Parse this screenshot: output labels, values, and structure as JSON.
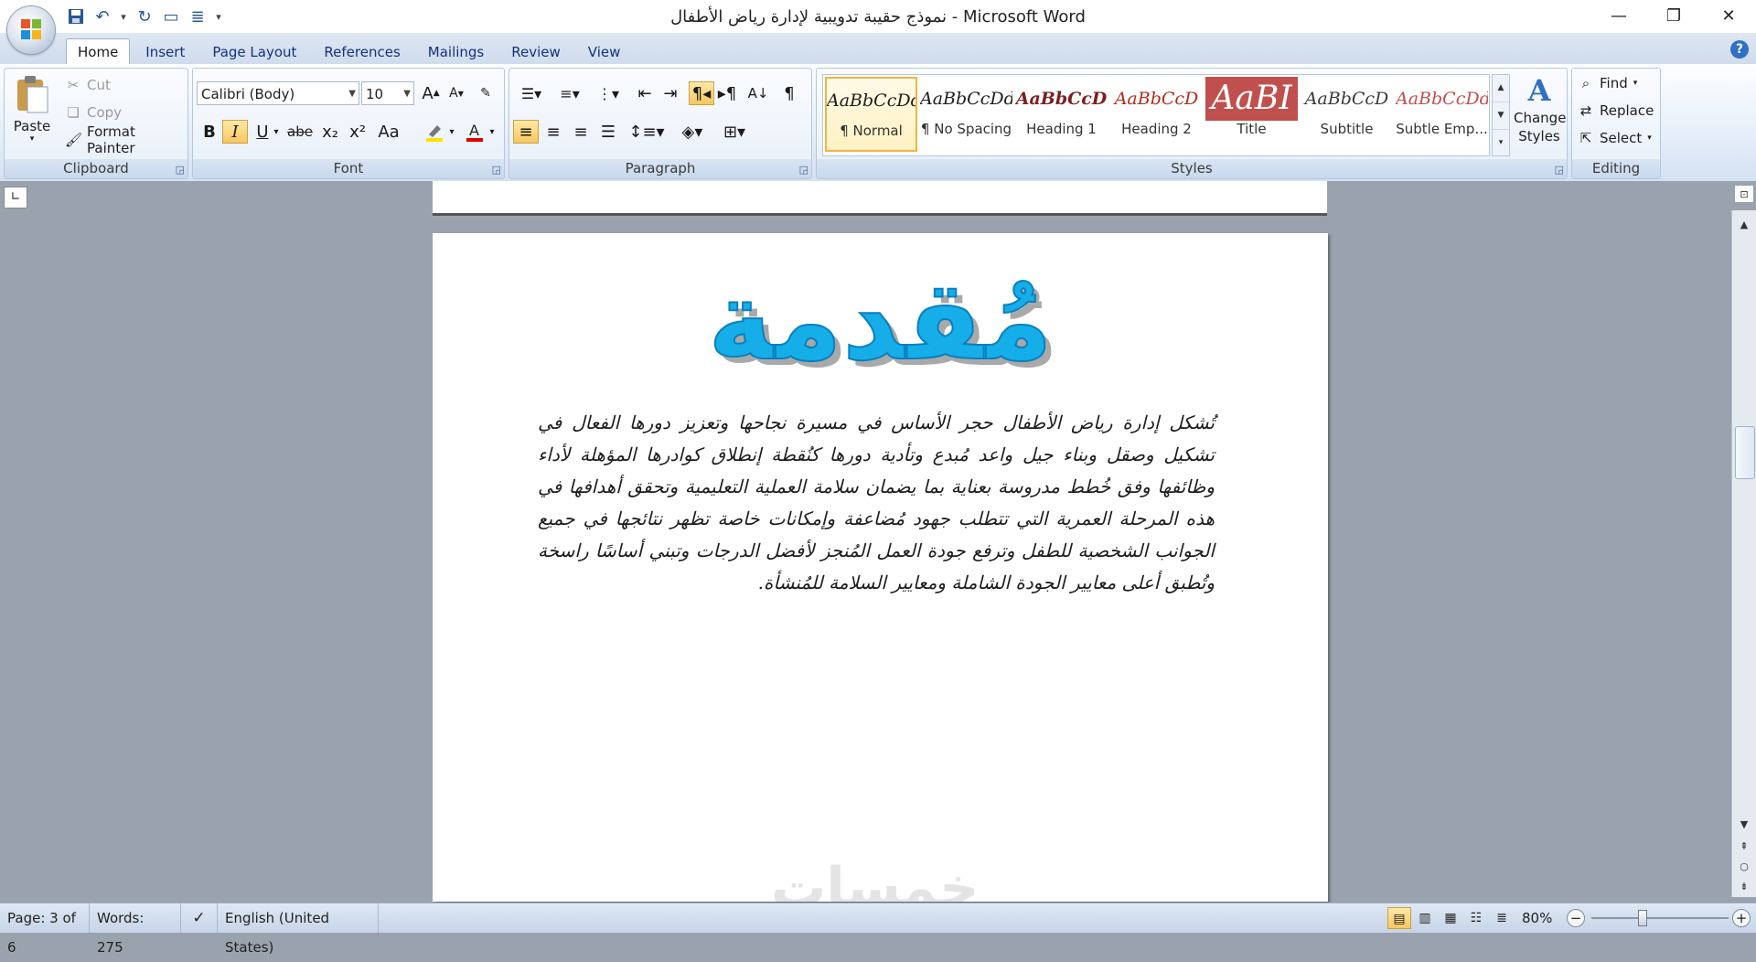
{
  "app": {
    "window_title": "نموذج حقيبة تدويبية لإدارة رياض الأطفال - Microsoft Word"
  },
  "tabs": [
    {
      "label": "Home",
      "active": true
    },
    {
      "label": "Insert"
    },
    {
      "label": "Page Layout"
    },
    {
      "label": "References"
    },
    {
      "label": "Mailings"
    },
    {
      "label": "Review"
    },
    {
      "label": "View"
    }
  ],
  "clipboard": {
    "group_label": "Clipboard",
    "paste": "Paste",
    "cut": "Cut",
    "copy": "Copy",
    "format_painter": "Format Painter"
  },
  "font": {
    "group_label": "Font",
    "font_name": "Calibri (Body)",
    "font_size": "10",
    "bold": "B",
    "italic": "I",
    "underline": "U",
    "strikethrough": "abe",
    "subscript": "x₂",
    "superscript": "x²",
    "change_case": "Aa"
  },
  "paragraph": {
    "group_label": "Paragraph",
    "pilcrow": "¶"
  },
  "styles": {
    "group_label": "Styles",
    "items": [
      {
        "sample": "AaBbCcDdE",
        "name": "¶ Normal"
      },
      {
        "sample": "AaBbCcDdE",
        "name": "¶ No Spacing"
      },
      {
        "sample": "AaBbCcD",
        "name": "Heading 1"
      },
      {
        "sample": "AaBbCcD",
        "name": "Heading 2"
      },
      {
        "sample": "AaBI",
        "name": "Title"
      },
      {
        "sample": "AaBbCcD",
        "name": "Subtitle"
      },
      {
        "sample": "AaBbCcDd",
        "name": "Subtle Emp..."
      }
    ],
    "change_styles": "Change Styles"
  },
  "editing": {
    "group_label": "Editing",
    "find": "Find",
    "replace": "Replace",
    "select": "Select"
  },
  "document": {
    "heading": "مُقدمة",
    "body": "تُشكل إدارة رياض الأطفال حجر الأساس في مسيرة نجاحها وتعزيز دورها الفعال في تشكيل وصقل وبناء جيل واعد مُبدع وتأدية دورها كنُقطة إنطلاق كوادرها المؤهلة لأداء وظائفها وفق خُطط مدروسة بعناية بما يضمان سلامة العملية التعليمية وتحقق أهدافها في هذه المرحلة العمرية التي تتطلب جهود مُضاعفة وإمكانات خاصة تظهر نتائجها في جميع الجوانب الشخصية للطفل وترفع جودة العمل المُنجز لأفضل الدرجات وتبني أساسًا راسخة وتُطبق أعلى معايير الجودة الشاملة ومعايير السلامة للمُنشأة.",
    "watermark": "خمسات"
  },
  "status": {
    "page": "Page: 3 of 6",
    "words": "Words: 275",
    "language": "English (United States)",
    "zoom": "80%",
    "zoom_fraction": 0.5
  }
}
